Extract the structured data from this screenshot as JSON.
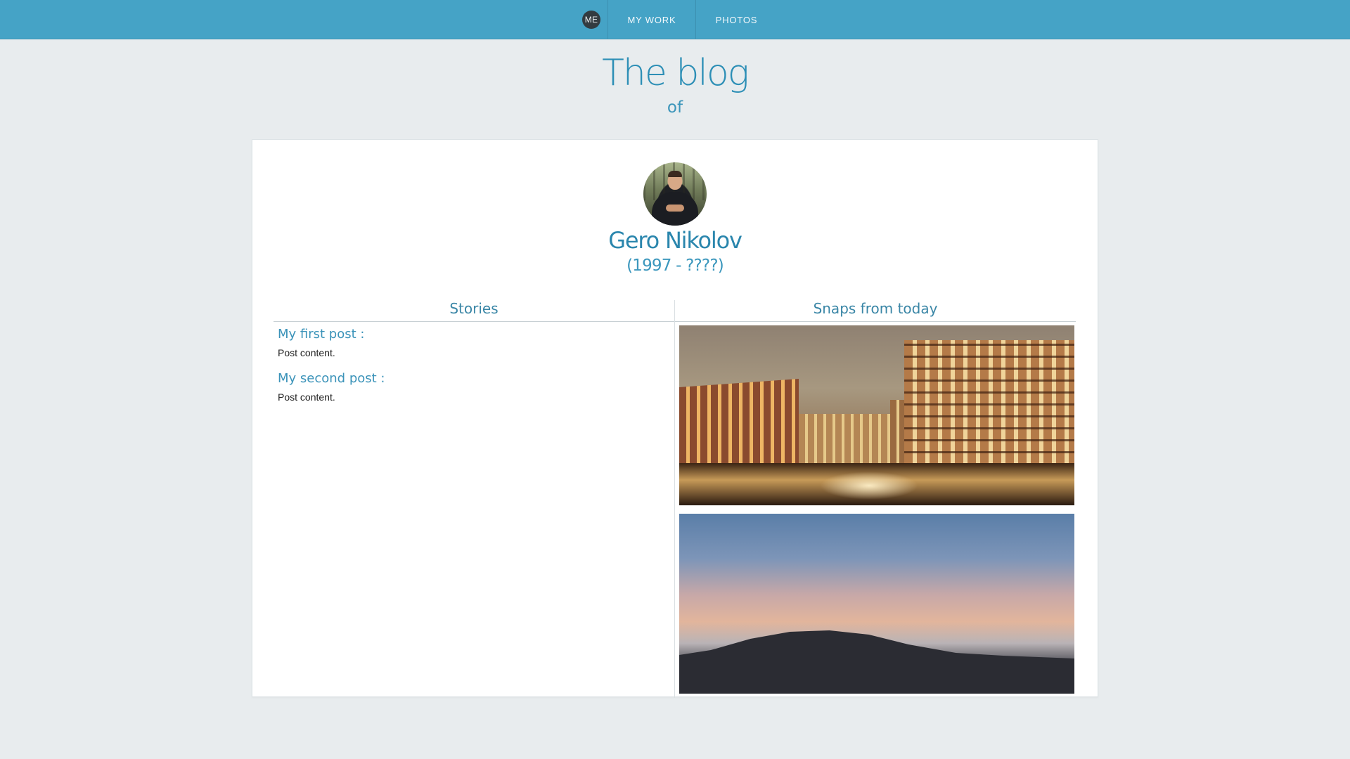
{
  "nav": {
    "me_label": "ME",
    "items": [
      {
        "label": "MY WORK"
      },
      {
        "label": "PHOTOS"
      }
    ]
  },
  "header": {
    "title": "The blog",
    "subtitle": "of"
  },
  "profile": {
    "name": "Gero Nikolov",
    "years": "(1997 - ????)"
  },
  "columns": {
    "stories_heading": "Stories",
    "snaps_heading": "Snaps from today"
  },
  "posts": [
    {
      "title": "My first post :",
      "content": "Post content."
    },
    {
      "title": "My second post :",
      "content": "Post content."
    }
  ],
  "colors": {
    "nav_bg": "#45a3c6",
    "page_bg": "#e8ecee",
    "accent": "#2d8fb6"
  }
}
